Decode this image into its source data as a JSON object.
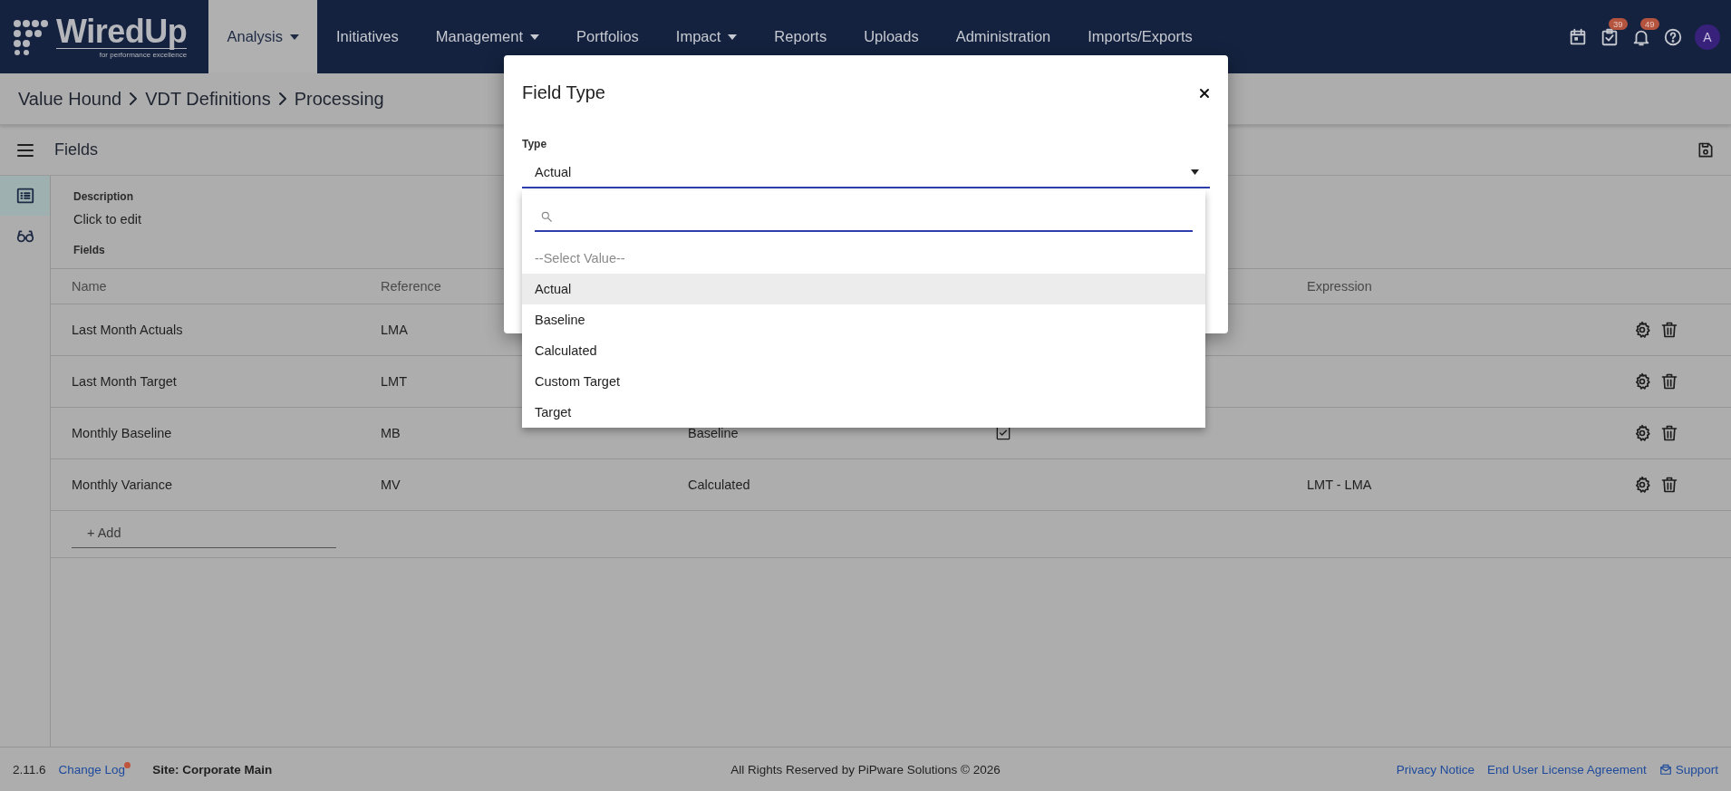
{
  "header": {
    "logo": {
      "name": "WiredUp",
      "tagline": "for performance excellence"
    },
    "nav": [
      {
        "label": "Analysis",
        "has_menu": true,
        "selected": true
      },
      {
        "label": "Initiatives",
        "has_menu": false,
        "selected": false
      },
      {
        "label": "Management",
        "has_menu": true,
        "selected": false
      },
      {
        "label": "Portfolios",
        "has_menu": false,
        "selected": false
      },
      {
        "label": "Impact",
        "has_menu": true,
        "selected": false
      },
      {
        "label": "Reports",
        "has_menu": false,
        "selected": false
      },
      {
        "label": "Uploads",
        "has_menu": false,
        "selected": false
      },
      {
        "label": "Administration",
        "has_menu": false,
        "selected": false
      },
      {
        "label": "Imports/Exports",
        "has_menu": false,
        "selected": false
      }
    ],
    "icons": [
      {
        "kind": "calendar"
      },
      {
        "kind": "tasks",
        "badge": "39"
      },
      {
        "kind": "bell",
        "badge": "49"
      },
      {
        "kind": "help"
      }
    ],
    "avatar": "A"
  },
  "breadcrumb": [
    "Value Hound",
    "VDT Definitions",
    "Processing"
  ],
  "toolbar": {
    "title": "Fields"
  },
  "side_rail": [
    {
      "kind": "list",
      "selected": true
    },
    {
      "kind": "glasses",
      "selected": false
    }
  ],
  "description": {
    "label": "Description",
    "value": "Click to edit"
  },
  "fields": {
    "label": "Fields",
    "columns": {
      "name": "Name",
      "reference": "Reference",
      "expression": "Expression"
    },
    "rows": [
      {
        "name": "Last Month Actuals",
        "reference": "LMA"
      },
      {
        "name": "Last Month Target",
        "reference": "LMT"
      },
      {
        "name": "Monthly Baseline",
        "reference": "MB",
        "column_3": "Baseline",
        "checked": true
      },
      {
        "name": "Monthly Variance",
        "reference": "MV",
        "column_3": "Calculated",
        "checked": false,
        "expression": "LMT - LMA"
      }
    ],
    "add_label": "+ Add"
  },
  "modal": {
    "title": "Field Type",
    "field_label": "Type",
    "value": "Actual",
    "options": [
      {
        "label": "--Select Value--",
        "kind": "placeholder",
        "selected": false
      },
      {
        "label": "Actual",
        "kind": "option",
        "selected": true
      },
      {
        "label": "Baseline",
        "kind": "option",
        "selected": false
      },
      {
        "label": "Calculated",
        "kind": "option",
        "selected": false
      },
      {
        "label": "Custom Target",
        "kind": "option",
        "selected": false
      },
      {
        "label": "Target",
        "kind": "option",
        "selected": false
      }
    ]
  },
  "footer": {
    "version": "2.11.6",
    "change_log": {
      "label": "Change Log",
      "has_update": true
    },
    "site": "Site: Corporate Main",
    "copyright": "All Rights Reserved by PiPware Solutions © 2026",
    "links": [
      {
        "label": "Privacy Notice",
        "kind": "link"
      },
      {
        "label": "End User License Agreement",
        "kind": "link"
      },
      {
        "label": "Support",
        "kind": "support"
      }
    ]
  }
}
